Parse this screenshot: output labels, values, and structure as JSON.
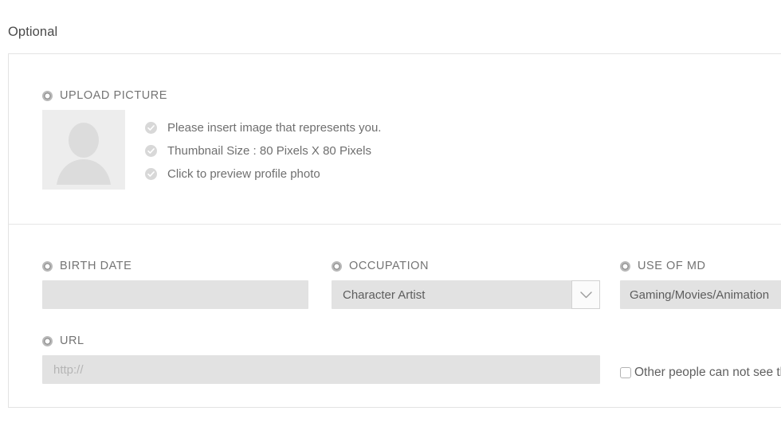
{
  "section": {
    "heading": "Optional"
  },
  "upload": {
    "label": "UPLOAD PICTURE",
    "avatar_icon": "person-placeholder-icon",
    "hints": [
      "Please insert image that represents you.",
      "Thumbnail Size : 80 Pixels X 80 Pixels",
      "Click to preview profile photo"
    ]
  },
  "fields": {
    "birth_date": {
      "label": "BIRTH DATE",
      "value": "",
      "placeholder": ""
    },
    "occupation": {
      "label": "OCCUPATION",
      "value": "Character Artist",
      "chevron_icon": "chevron-down-icon"
    },
    "use_of_md": {
      "label": "USE OF MD",
      "value": "Gaming/Movies/Animation",
      "placeholder": ""
    },
    "url": {
      "label": "URL",
      "value": "",
      "placeholder": "http://"
    },
    "privacy": {
      "label": "Other people can not see this"
    }
  },
  "icons": {
    "bullet": "bullet-ring-icon",
    "check": "check-circle-icon"
  },
  "colors": {
    "card_border": "#e3e3e3",
    "input_background": "#e2e2e2",
    "label_text": "#747474",
    "hint_text": "#6f6f6f",
    "avatar_background": "#ededed",
    "divider": "#e6e6e6"
  }
}
